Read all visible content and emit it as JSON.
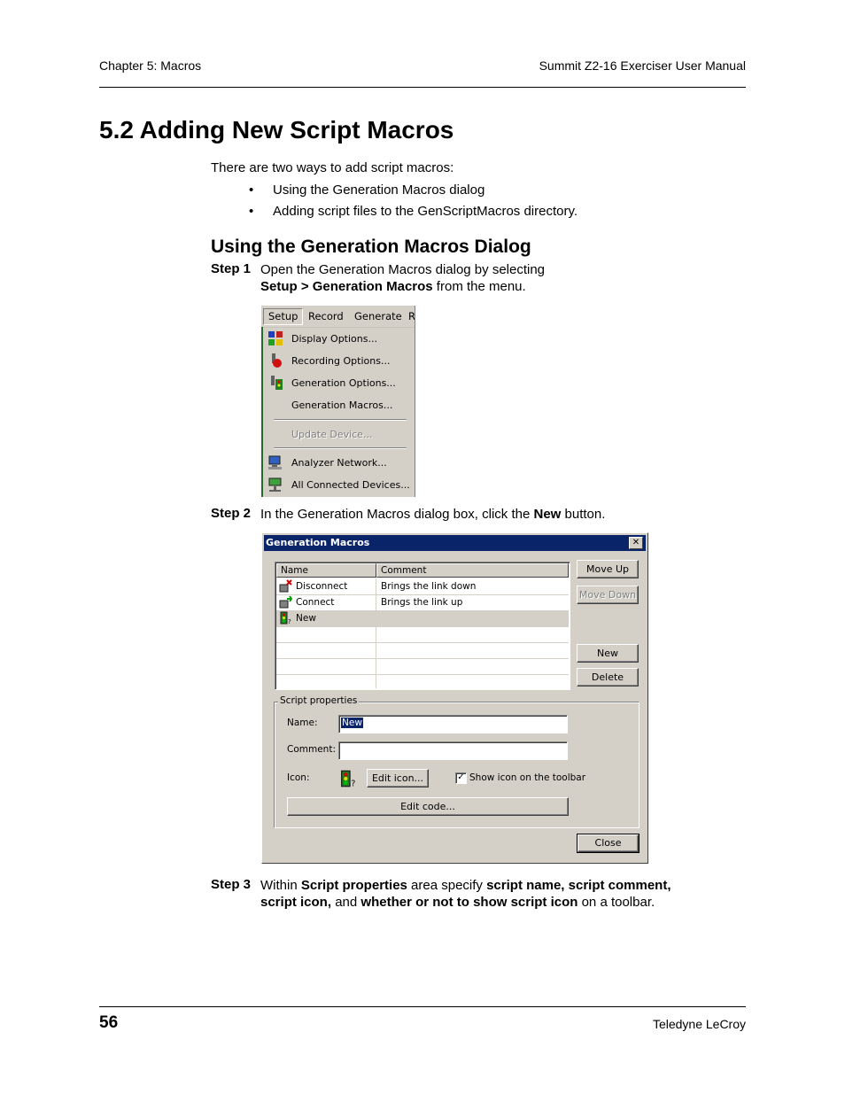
{
  "header": {
    "chapter": "Chapter 5: Macros",
    "manual": "Summit Z2-16 Exerciser User Manual"
  },
  "title": "5.2 Adding New Script Macros",
  "intro": "There are two ways to add script macros:",
  "bullets": [
    "Using the Generation Macros dialog",
    "Adding script files to the GenScriptMacros directory."
  ],
  "subheading": "Using the Generation Macros Dialog",
  "steps": [
    {
      "label": "Step 1",
      "line1": "Open the Generation Macros dialog by selecting",
      "line2_bold": "Setup > Generation Macros",
      "line2_rest": " from the menu."
    },
    {
      "label": "Step 2",
      "text": "In the Generation Macros dialog box, click the ",
      "bold": "New",
      "text_end": " button."
    },
    {
      "label": "Step 3",
      "t1": "Within ",
      "b1": "Script properties",
      "t2": " area specify ",
      "b2": "script name, script comment,",
      "b3": "script icon,",
      "t3": " and ",
      "b4": "whether or not to show script icon",
      "t4": " on a toolbar."
    }
  ],
  "menu": {
    "bar": [
      "Setup",
      "Record",
      "Generate",
      "R"
    ],
    "items": [
      {
        "label": "Display Options...",
        "icon": "display-options-icon",
        "disabled": false
      },
      {
        "label": "Recording Options...",
        "icon": "recording-options-icon",
        "disabled": false
      },
      {
        "label": "Generation Options...",
        "icon": "generation-options-icon",
        "disabled": false
      },
      {
        "label": "Generation Macros...",
        "icon": "",
        "disabled": false
      },
      {
        "label": "Update Device...",
        "icon": "",
        "disabled": true
      },
      {
        "label": "Analyzer Network...",
        "icon": "analyzer-network-icon",
        "disabled": false
      },
      {
        "label": "All Connected Devices...",
        "icon": "connected-devices-icon",
        "disabled": false
      }
    ]
  },
  "dialog": {
    "title": "Generation Macros",
    "columns": [
      "Name",
      "Comment"
    ],
    "rows": [
      {
        "name": "Disconnect",
        "comment": "Brings the link down",
        "icon": "disconnect-icon"
      },
      {
        "name": "Connect",
        "comment": "Brings the link up",
        "icon": "connect-icon"
      },
      {
        "name": "New",
        "comment": "",
        "icon": "traffic-light-icon"
      }
    ],
    "buttons": {
      "move_up": "Move Up",
      "move_down": "Move Down",
      "new": "New",
      "delete": "Delete",
      "close": "Close",
      "edit_icon": "Edit icon...",
      "edit_code": "Edit code..."
    },
    "group_label": "Script properties",
    "name_label": "Name:",
    "name_value": "New",
    "comment_label": "Comment:",
    "comment_value": "",
    "icon_label": "Icon:",
    "show_icon_label": "Show icon on the toolbar",
    "show_icon_checked": true
  },
  "footer": {
    "page": "56",
    "company": "Teledyne LeCroy"
  }
}
